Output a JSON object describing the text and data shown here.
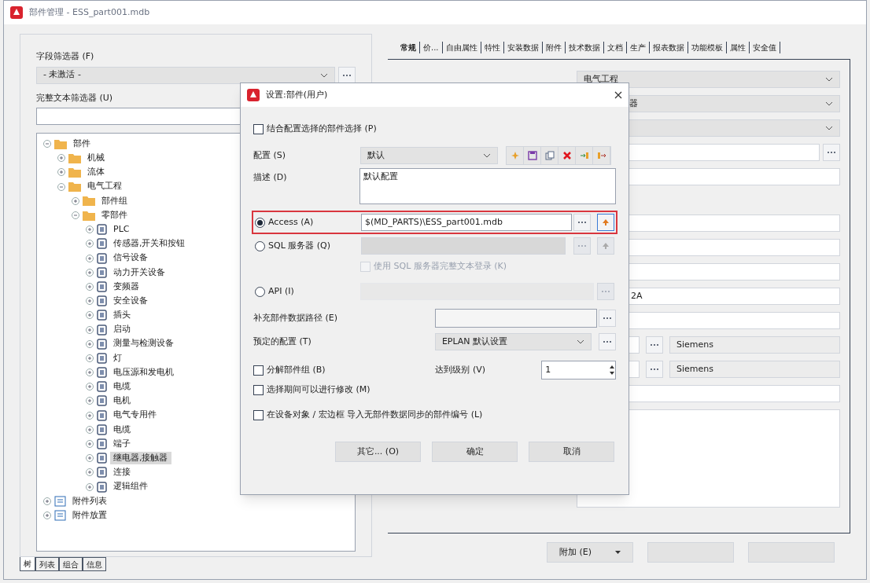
{
  "window": {
    "title": "部件管理 - ESS_part001.mdb"
  },
  "left": {
    "field_filter": {
      "label": "字段筛选器 (F)",
      "value": "- 未激活 -"
    },
    "text_filter": {
      "label": "完整文本筛选器 (U)"
    },
    "tree": [
      {
        "label": "部件",
        "kind": "folder",
        "expanded": true,
        "selected": false,
        "children": [
          {
            "label": "机械",
            "kind": "folder",
            "expanded": false,
            "selected": false
          },
          {
            "label": "流体",
            "kind": "folder",
            "expanded": false,
            "selected": false
          },
          {
            "label": "电气工程",
            "kind": "folder",
            "expanded": true,
            "selected": false,
            "children": [
              {
                "label": "部件组",
                "kind": "folder",
                "expanded": false,
                "selected": false
              },
              {
                "label": "零部件",
                "kind": "folder",
                "expanded": true,
                "selected": false,
                "children": [
                  {
                    "label": "PLC",
                    "kind": "part",
                    "expanded": false,
                    "selected": false
                  },
                  {
                    "label": "传感器,开关和按钮",
                    "kind": "part",
                    "expanded": false,
                    "selected": false
                  },
                  {
                    "label": "信号设备",
                    "kind": "part",
                    "expanded": false,
                    "selected": false
                  },
                  {
                    "label": "动力开关设备",
                    "kind": "part",
                    "expanded": false,
                    "selected": false
                  },
                  {
                    "label": "变频器",
                    "kind": "part",
                    "expanded": false,
                    "selected": false
                  },
                  {
                    "label": "安全设备",
                    "kind": "part",
                    "expanded": false,
                    "selected": false
                  },
                  {
                    "label": "插头",
                    "kind": "part",
                    "expanded": false,
                    "selected": false
                  },
                  {
                    "label": "启动",
                    "kind": "part",
                    "expanded": false,
                    "selected": false
                  },
                  {
                    "label": "测量与检测设备",
                    "kind": "part",
                    "expanded": false,
                    "selected": false
                  },
                  {
                    "label": "灯",
                    "kind": "part",
                    "expanded": false,
                    "selected": false
                  },
                  {
                    "label": "电压源和发电机",
                    "kind": "part",
                    "expanded": false,
                    "selected": false
                  },
                  {
                    "label": "电缆",
                    "kind": "part",
                    "expanded": false,
                    "selected": false
                  },
                  {
                    "label": "电机",
                    "kind": "part",
                    "expanded": false,
                    "selected": false
                  },
                  {
                    "label": "电气专用件",
                    "kind": "part",
                    "expanded": false,
                    "selected": false
                  },
                  {
                    "label": "电缆",
                    "kind": "part",
                    "expanded": false,
                    "selected": false
                  },
                  {
                    "label": "端子",
                    "kind": "part",
                    "expanded": false,
                    "selected": false
                  },
                  {
                    "label": "继电器,接触器",
                    "kind": "part",
                    "expanded": false,
                    "selected": true
                  },
                  {
                    "label": "连接",
                    "kind": "part",
                    "expanded": false,
                    "selected": false
                  },
                  {
                    "label": "逻辑组件",
                    "kind": "part",
                    "expanded": false,
                    "selected": false
                  }
                ]
              }
            ]
          }
        ]
      },
      {
        "label": "附件列表",
        "kind": "list",
        "expanded": false,
        "selected": false
      },
      {
        "label": "附件放置",
        "kind": "list",
        "expanded": false,
        "selected": false
      }
    ],
    "tabs": [
      {
        "label": "树",
        "selected": true
      },
      {
        "label": "列表",
        "selected": false
      },
      {
        "label": "组合",
        "selected": false
      },
      {
        "label": "信息",
        "selected": false
      }
    ]
  },
  "right": {
    "tabs": [
      {
        "label": "常规",
        "selected": true
      },
      {
        "label": "价...",
        "selected": false
      },
      {
        "label": "自由属性",
        "selected": false
      },
      {
        "label": "特性",
        "selected": false
      },
      {
        "label": "安装数据",
        "selected": false
      },
      {
        "label": "附件",
        "selected": false
      },
      {
        "label": "技术数据",
        "selected": false
      },
      {
        "label": "文档",
        "selected": false
      },
      {
        "label": "生产",
        "selected": false
      },
      {
        "label": "报表数据",
        "selected": false
      },
      {
        "label": "功能模板",
        "selected": false
      },
      {
        "label": "属性",
        "selected": false
      },
      {
        "label": "安全值",
        "selected": false
      }
    ],
    "fields": [
      {
        "kind": "dropdown",
        "value": "电气工程"
      },
      {
        "kind": "dropdown",
        "value": "器",
        "clipped": true
      },
      {
        "kind": "dropdown"
      },
      {
        "kind": "browse"
      },
      {
        "kind": "text"
      },
      {
        "kind": "gap"
      },
      {
        "kind": "text"
      },
      {
        "kind": "text"
      },
      {
        "kind": "text"
      },
      {
        "kind": "text",
        "value": "2A",
        "clipped": true
      },
      {
        "kind": "text"
      },
      {
        "kind": "maker",
        "value": "Siemens"
      },
      {
        "kind": "maker",
        "value": "Siemens"
      },
      {
        "kind": "text"
      },
      {
        "kind": "memo"
      }
    ],
    "buttons": [
      {
        "kind": "menu",
        "label": "附加 (E)"
      },
      {
        "kind": "plain"
      },
      {
        "kind": "plain"
      }
    ]
  },
  "dialog": {
    "title": "设置:部件(用户)",
    "include_config": {
      "label": "结合配置选择的部件选择 (P)",
      "checked": false
    },
    "config": {
      "label": "配置 (S)",
      "value": "默认"
    },
    "description": {
      "label": "描述 (D)",
      "value": "默认配置"
    },
    "sources": [
      {
        "kind": "file",
        "label": "Access (A)",
        "selected": true,
        "highlighted": true,
        "value": "$(MD_PARTS)\\ESS_part001.mdb"
      },
      {
        "kind": "server",
        "label": "SQL 服务器 (Q)",
        "selected": false,
        "highlighted": false,
        "login_option": {
          "label": "使用 SQL 服务器完整文本登录 (K)",
          "checked": false,
          "disabled": true
        }
      },
      {
        "kind": "api",
        "label": "API (I)",
        "selected": false,
        "highlighted": false
      }
    ],
    "supplement": {
      "label": "补充部件数据路径 (E)"
    },
    "preset": {
      "label": "预定的配置 (T)",
      "value": "EPLAN 默认设置"
    },
    "split_groups": {
      "label": "分解部件组 (B)",
      "checked": false
    },
    "level": {
      "label": "达到级别 (V)",
      "value": "1"
    },
    "options": [
      {
        "label": "选择期间可以进行修改 (M)",
        "checked": false
      },
      {
        "label": "在设备对象 / 宏边框 导入无部件数据同步的部件编号 (L)",
        "checked": false
      }
    ],
    "buttons": [
      "其它... (O)",
      "确定",
      "取消"
    ]
  }
}
